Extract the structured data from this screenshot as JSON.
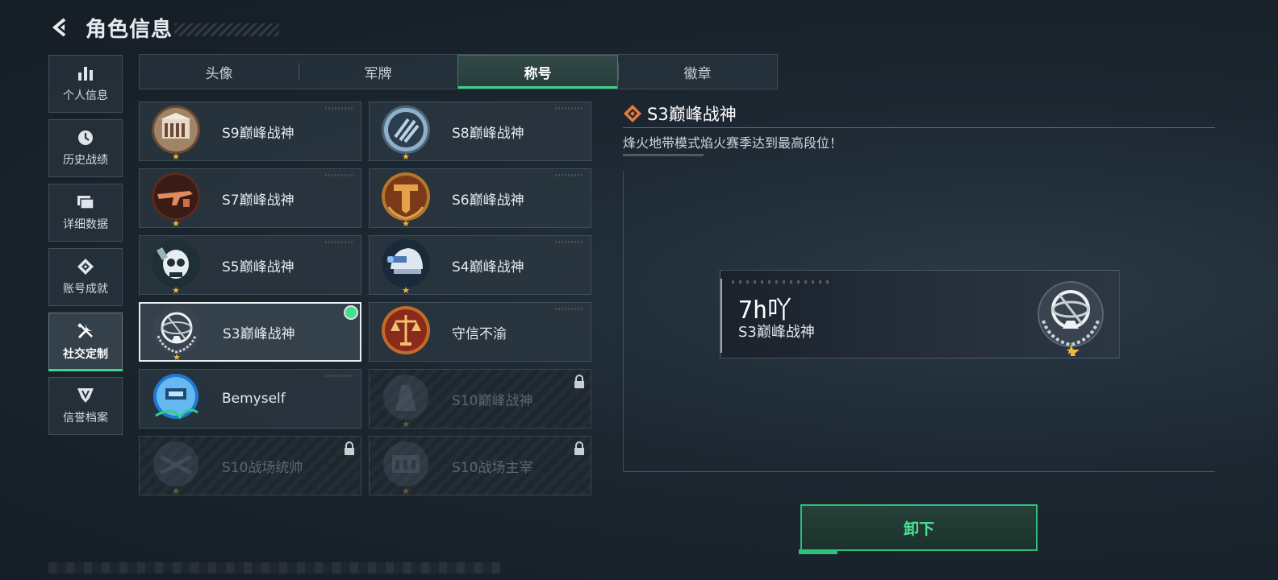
{
  "header": {
    "title": "角色信息"
  },
  "nav": [
    {
      "label": "个人信息",
      "icon": "bar-chart-icon"
    },
    {
      "label": "历史战绩",
      "icon": "history-clock-icon"
    },
    {
      "label": "详细数据",
      "icon": "folder-icon"
    },
    {
      "label": "账号成就",
      "icon": "achievement-icon"
    },
    {
      "label": "社交定制",
      "icon": "tools-icon",
      "active": true
    },
    {
      "label": "信誉档案",
      "icon": "credit-badge-icon"
    }
  ],
  "tabs": [
    {
      "label": "头像"
    },
    {
      "label": "军牌"
    },
    {
      "label": "称号",
      "active": true
    },
    {
      "label": "徽章"
    }
  ],
  "titles": [
    {
      "name": "S9巅峰战神",
      "state": "available"
    },
    {
      "name": "S8巅峰战神",
      "state": "available"
    },
    {
      "name": "S7巅峰战神",
      "state": "available"
    },
    {
      "name": "S6巅峰战神",
      "state": "available"
    },
    {
      "name": "S5巅峰战神",
      "state": "available"
    },
    {
      "name": "S4巅峰战神",
      "state": "available"
    },
    {
      "name": "S3巅峰战神",
      "state": "equipped"
    },
    {
      "name": "守信不渝",
      "state": "available"
    },
    {
      "name": "Bemyself",
      "state": "available"
    },
    {
      "name": "S10巅峰战神",
      "state": "locked"
    },
    {
      "name": "S10战场统帅",
      "state": "locked"
    },
    {
      "name": "S10战场主宰",
      "state": "locked"
    }
  ],
  "detail": {
    "title": "S3巅峰战神",
    "description": "烽火地带模式焰火赛季达到最高段位！",
    "preview_username": "7h吖",
    "preview_title": "S3巅峰战神"
  },
  "actions": {
    "unequip_label": "卸下"
  },
  "colors": {
    "accent_green": "#3fd38a",
    "star_gold": "#f0b93a",
    "diamond_orange": "#e8793a"
  }
}
